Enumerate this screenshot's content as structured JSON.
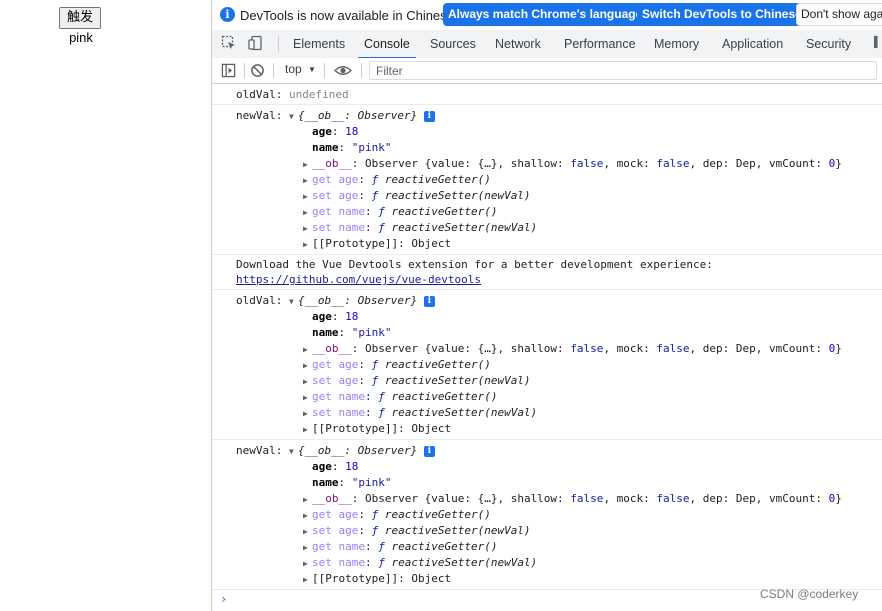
{
  "page": {
    "button_label": "触发",
    "name_text": "pink"
  },
  "infobar": {
    "icon": "info-icon",
    "message": "DevTools is now available in Chinese!",
    "btn_match": "Always match Chrome's language",
    "btn_switch": "Switch DevTools to Chinese",
    "btn_dont_show": "Don't show again"
  },
  "tabs": {
    "items": [
      "Elements",
      "Console",
      "Sources",
      "Network",
      "Performance",
      "Memory",
      "Application",
      "Security"
    ],
    "active": "Console"
  },
  "toolbar": {
    "context": "top",
    "filter_placeholder": "Filter"
  },
  "console": {
    "log1": {
      "label": "oldVal:",
      "value": "undefined"
    },
    "obj_header": "{__ob__: Observer}",
    "props": {
      "age_key": "age",
      "age_val": "18",
      "name_key": "name",
      "name_val": "\"pink\"",
      "ob_key": "__ob__",
      "ob_summary_pre": "Observer {value: {…}, shallow: ",
      "ob_shallow": "false",
      "ob_mid": ", mock: ",
      "ob_mock": "false",
      "ob_dep": ", dep: Dep, vmCount: ",
      "ob_vm": "0",
      "ob_end": "}",
      "get_age": "get age",
      "set_age": "set age",
      "get_name": "get name",
      "set_name": "set name",
      "f_glyph": "ƒ",
      "getter": "reactiveGetter()",
      "setter": "reactiveSetter(newVal)",
      "proto": "[[Prototype]]",
      "proto_val": "Object"
    },
    "labels": {
      "new": "newVal:",
      "old": "oldVal:"
    },
    "download_msg": "Download the Vue Devtools extension for a better development experience:",
    "download_link": "https://github.com/vuejs/vue-devtools"
  },
  "watermark": "CSDN @coderkey"
}
